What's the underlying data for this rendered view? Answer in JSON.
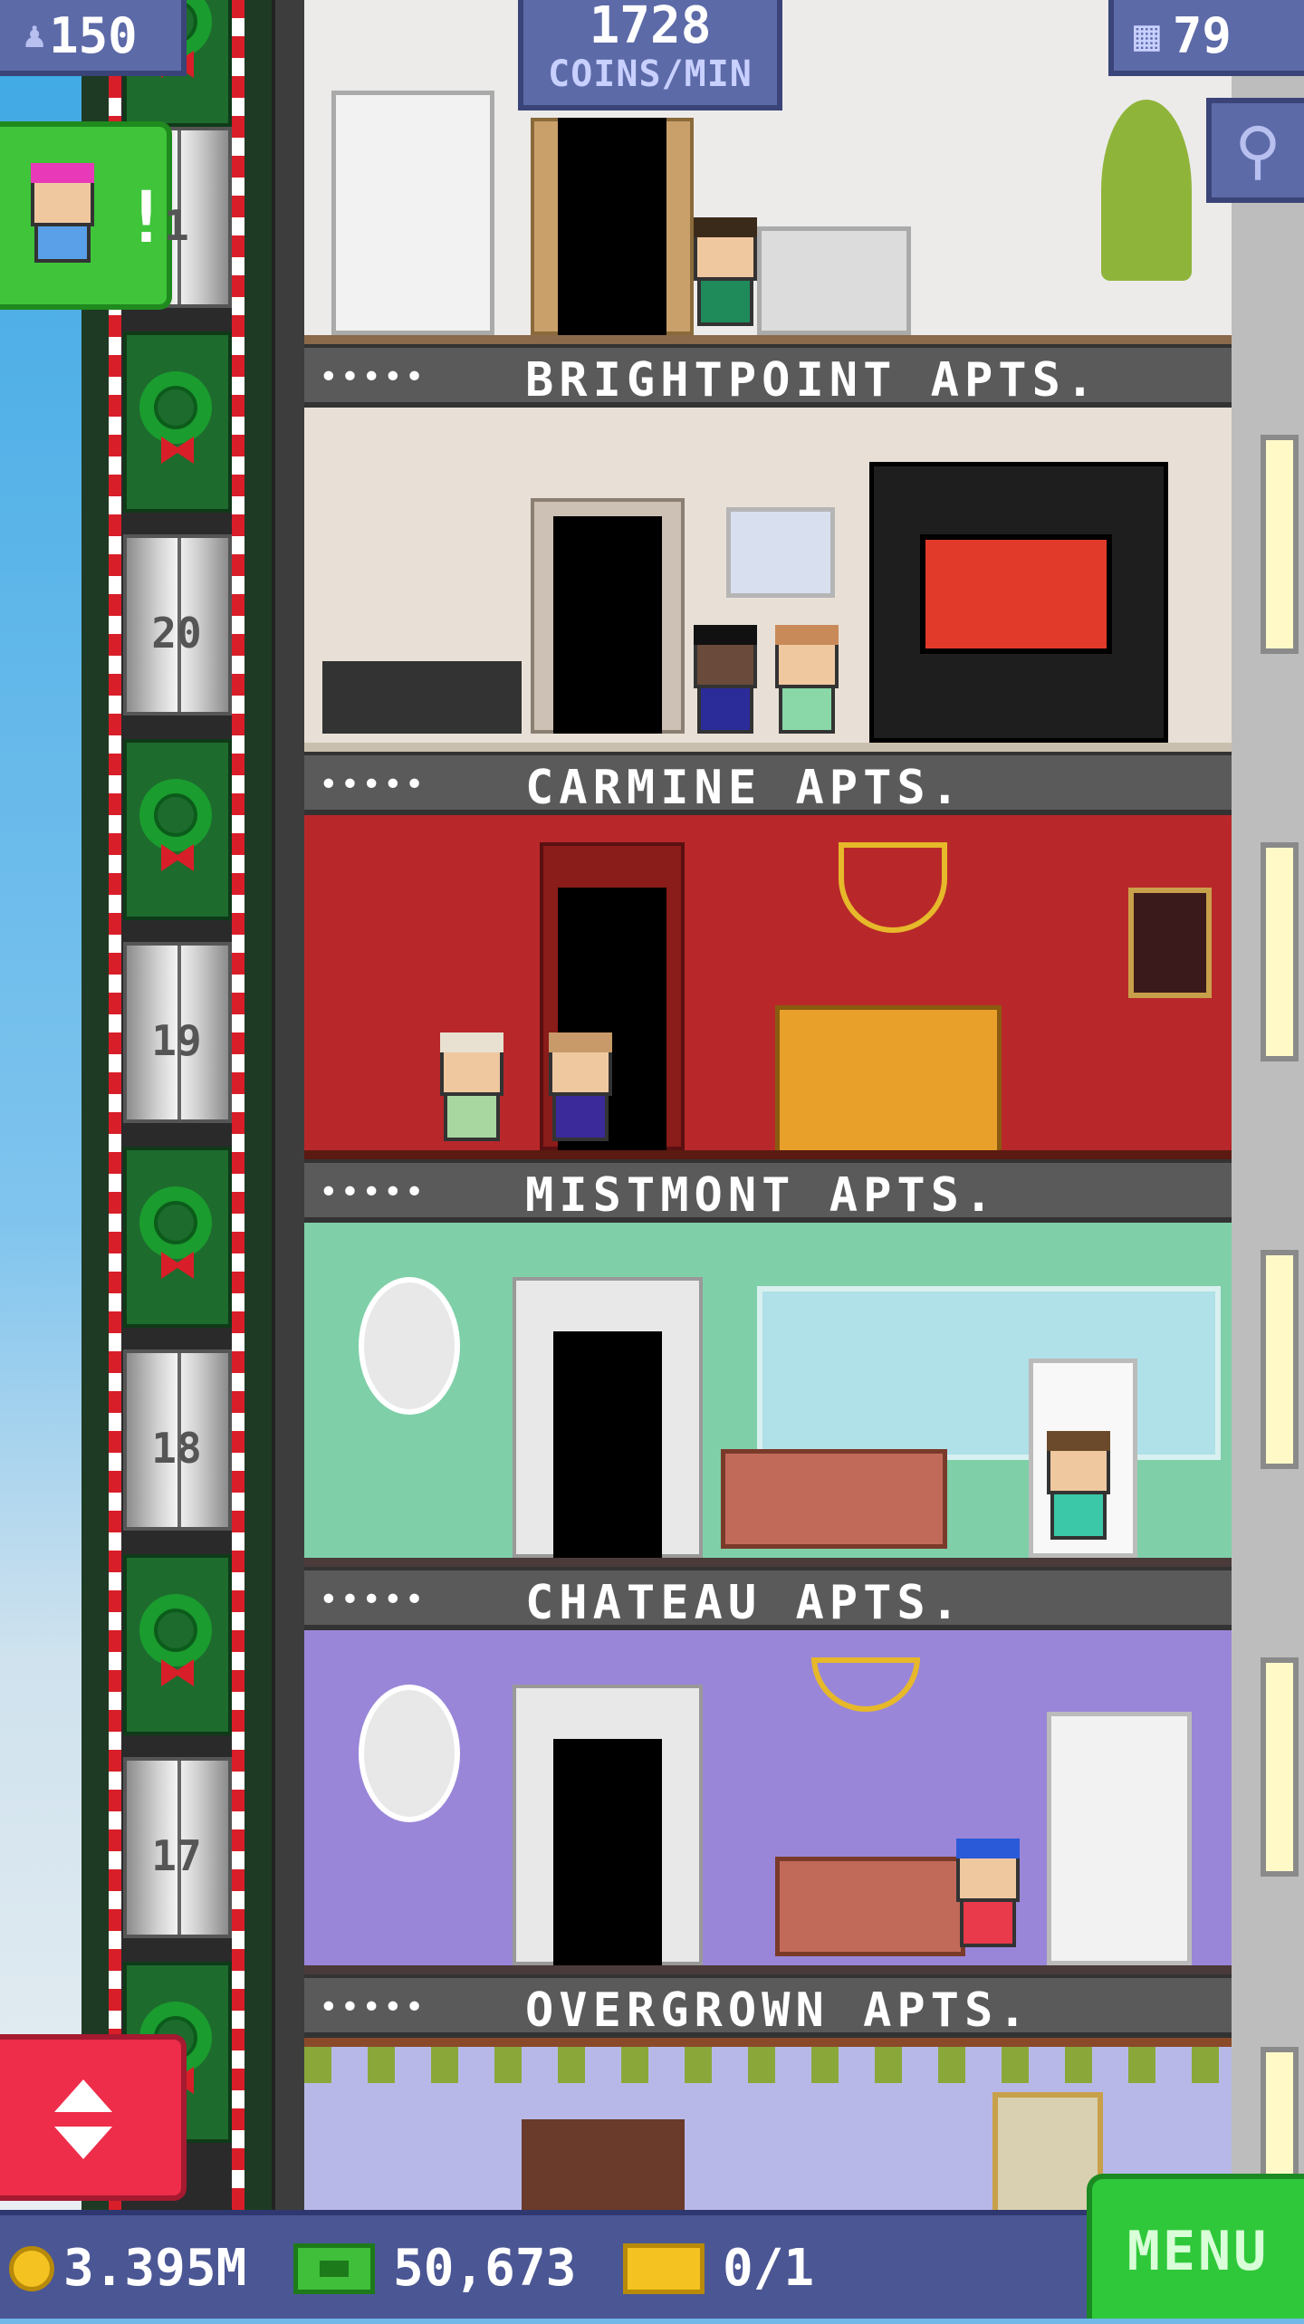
{
  "hud": {
    "population": "150",
    "coins_per_min_value": "1728",
    "coins_per_min_label": "COINS/MIN",
    "floors": "79"
  },
  "elevator": {
    "floor_numbers": [
      "1",
      "20",
      "19",
      "18",
      "17"
    ]
  },
  "floors": [
    {
      "name": "BRIGHTPOINT APTS.",
      "stars": "•••••"
    },
    {
      "name": "CARMINE APTS.",
      "stars": "•••••"
    },
    {
      "name": "MISTMONT APTS.",
      "stars": "•••••"
    },
    {
      "name": "CHATEAU APTS.",
      "stars": "•••••"
    },
    {
      "name": "OVERGROWN APTS.",
      "stars": "•••••"
    }
  ],
  "bottom": {
    "coins": "3.395M",
    "bux": "50,673",
    "tickets": "0/1",
    "menu_label": "MENU"
  },
  "colors": {
    "hud_blue": "#5d6aa8",
    "menu_green": "#2fc83a",
    "elevator_red": "#ee2d4a"
  }
}
